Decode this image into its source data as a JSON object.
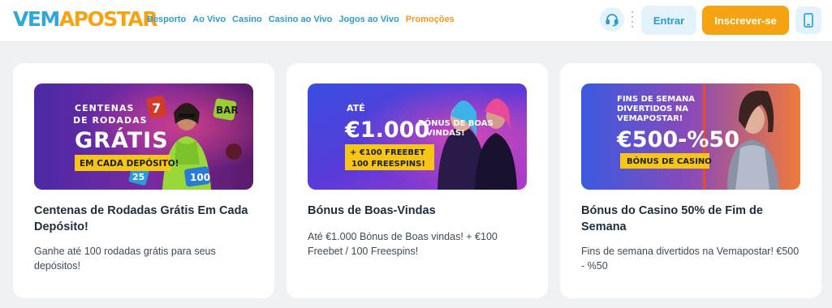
{
  "brand": {
    "logo_part1": "VEM",
    "logo_part2": "APOSTAR",
    "blue": "#2fa8d6",
    "orange": "#f5a312"
  },
  "nav": [
    {
      "label": "Desporto"
    },
    {
      "label": "Ao Vivo"
    },
    {
      "label": "Casino"
    },
    {
      "label": "Casino ao Vivo"
    },
    {
      "label": "Jogos ao Vivo"
    },
    {
      "label": "Promoções"
    }
  ],
  "header": {
    "support_icon": "headset-icon",
    "login_label": "Entrar",
    "register_label": "Inscrever-se",
    "mobile_icon": "smartphone-icon"
  },
  "promos": [
    {
      "banner": {
        "line1": "CENTENAS",
        "line2": "DE RODADAS",
        "big": "GRÁTIS",
        "tag": "EM CADA DEPÓSITO!"
      },
      "title": "Centenas de Rodadas Grátis Em Cada Depósito!",
      "description": "Ganhe até 100 rodadas grátis para seus depósitos!"
    },
    {
      "banner": {
        "line1": "ATÉ",
        "big": "€1.000",
        "side1": "BÓNUS DE BOAS",
        "side2": "VINDAS!",
        "tag1": "+ €100 FREEBET",
        "tag2": "100 FREESPINS!"
      },
      "title": "Bónus de Boas-Vindas",
      "description": "Até €1.000 Bónus de Boas vindas! + €100 Freebet / 100 Freespins!"
    },
    {
      "banner": {
        "line1": "FINS DE SEMANA",
        "line2": "DIVERTIDOS NA",
        "line3": "VEMAPOSTAR!",
        "big": "€500-%50",
        "tag": "BÓNUS DE CASINO"
      },
      "title": "Bónus do Casino 50% de Fim de Semana",
      "description": "Fins de semana divertidos na Vemapostar! €500 - %50"
    }
  ]
}
